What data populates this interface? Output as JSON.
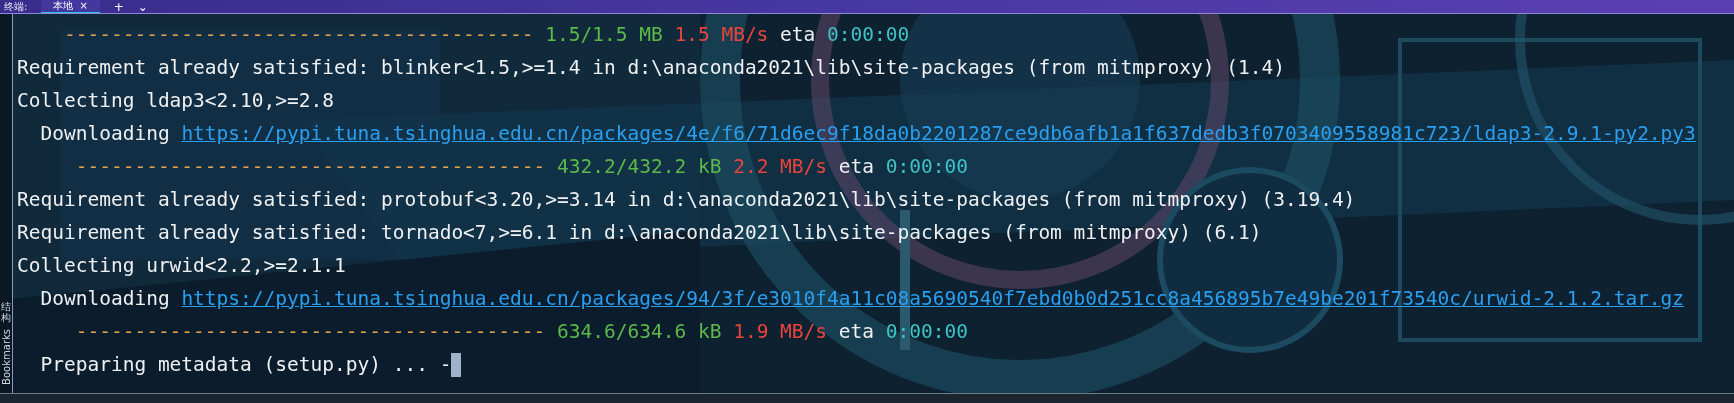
{
  "tab_bar": {
    "label": "终端:",
    "tabs": [
      {
        "label": "本地",
        "close": "×",
        "selected": true
      }
    ],
    "add": "+",
    "menu": "⌄"
  },
  "side_strip": {
    "items": [
      {
        "label": "结构"
      },
      {
        "label": "Bookmarks"
      }
    ]
  },
  "terminal": {
    "lines": [
      {
        "segments": [
          {
            "kind": "bar",
            "text": "    ----------------------------------------"
          },
          {
            "kind": "size",
            "text": " 1.5/1.5 MB"
          },
          {
            "kind": "rate",
            "text": " 1.5 MB/s"
          },
          {
            "kind": "text",
            "text": " eta "
          },
          {
            "kind": "eta",
            "text": "0:00:00"
          }
        ]
      },
      {
        "segments": [
          {
            "kind": "text",
            "text": "Requirement already satisfied: blinker<1.5,>=1.4 in d:\\anaconda2021\\lib\\site-packages (from mitmproxy) (1.4)"
          }
        ]
      },
      {
        "segments": [
          {
            "kind": "text",
            "text": "Collecting ldap3<2.10,>=2.8"
          }
        ]
      },
      {
        "segments": [
          {
            "kind": "text",
            "text": "  Downloading "
          },
          {
            "kind": "link",
            "text": "https://pypi.tuna.tsinghua.edu.cn/packages/4e/f6/71d6ec9f18da0b2201287ce9db6afb1a1f637dedb3f0703409558981c723/ldap3-2.9.1-py2.py3"
          }
        ]
      },
      {
        "segments": [
          {
            "kind": "bar",
            "text": "     ----------------------------------------"
          },
          {
            "kind": "size",
            "text": " 432.2/432.2 kB"
          },
          {
            "kind": "rate",
            "text": " 2.2 MB/s"
          },
          {
            "kind": "text",
            "text": " eta "
          },
          {
            "kind": "eta",
            "text": "0:00:00"
          }
        ]
      },
      {
        "segments": [
          {
            "kind": "text",
            "text": "Requirement already satisfied: protobuf<3.20,>=3.14 in d:\\anaconda2021\\lib\\site-packages (from mitmproxy) (3.19.4)"
          }
        ]
      },
      {
        "segments": [
          {
            "kind": "text",
            "text": "Requirement already satisfied: tornado<7,>=6.1 in d:\\anaconda2021\\lib\\site-packages (from mitmproxy) (6.1)"
          }
        ]
      },
      {
        "segments": [
          {
            "kind": "text",
            "text": "Collecting urwid<2.2,>=2.1.1"
          }
        ]
      },
      {
        "segments": [
          {
            "kind": "text",
            "text": "  Downloading "
          },
          {
            "kind": "link",
            "text": "https://pypi.tuna.tsinghua.edu.cn/packages/94/3f/e3010f4a11c08a5690540f7ebd0b0d251cc8a456895b7e49be201f73540c/urwid-2.1.2.tar.gz"
          }
        ]
      },
      {
        "segments": [
          {
            "kind": "bar",
            "text": "     ----------------------------------------"
          },
          {
            "kind": "size",
            "text": " 634.6/634.6 kB"
          },
          {
            "kind": "rate",
            "text": " 1.9 MB/s"
          },
          {
            "kind": "text",
            "text": " eta "
          },
          {
            "kind": "eta",
            "text": "0:00:00"
          }
        ]
      },
      {
        "segments": [
          {
            "kind": "text",
            "text": "  Preparing metadata (setup.py) ... -"
          }
        ],
        "cursor": true
      }
    ]
  }
}
